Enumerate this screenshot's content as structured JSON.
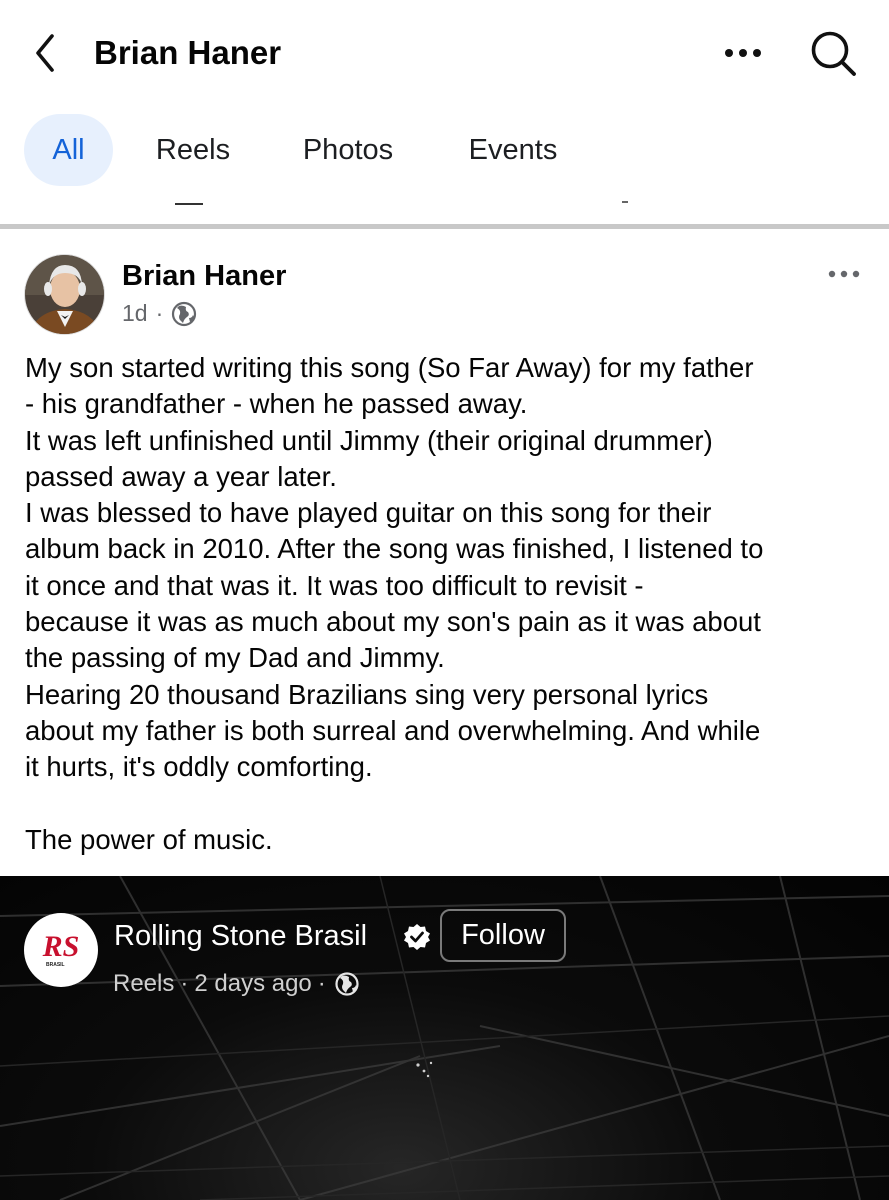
{
  "header": {
    "title": "Brian Haner",
    "back_icon": "chevron-left-icon",
    "more_icon": "more-horizontal-icon",
    "search_icon": "search-icon"
  },
  "tabs": [
    {
      "label": "All",
      "active": true
    },
    {
      "label": "Reels",
      "active": false
    },
    {
      "label": "Photos",
      "active": false
    },
    {
      "label": "Events",
      "active": false
    }
  ],
  "post": {
    "author": "Brian Haner",
    "time": "1d",
    "separator": "·",
    "audience_icon": "globe-icon",
    "body_lines": [
      "My son started writing this song (So Far Away) for my father",
      "- his grandfather - when he passed away.",
      "It was left unfinished until Jimmy (their original drummer)",
      "passed away a year later.",
      "I was blessed to have played guitar on this song for their",
      "album back in 2010. After the song was finished, I listened to",
      "it once and that was it. It was too difficult to revisit -",
      "because it was as much about my son's pain as it was about",
      "the passing of my Dad and Jimmy.",
      "Hearing 20 thousand Brazilians sing very personal lyrics",
      "about my father is both surreal and overwhelming. And while",
      "it hurts, it's oddly comforting.",
      "",
      "The power of music."
    ]
  },
  "shared_reel": {
    "page_name": "Rolling Stone Brasil",
    "logo_text": "RS",
    "logo_subtext": "BRASIL",
    "verified": true,
    "follow_label": "Follow",
    "type": "Reels",
    "time": "2 days ago",
    "separator": "·"
  },
  "colors": {
    "accent": "#1463d8",
    "tab_active_bg": "#e7f0fd",
    "text": "#050505",
    "muted": "#65676b",
    "rs_red": "#c8102e"
  }
}
